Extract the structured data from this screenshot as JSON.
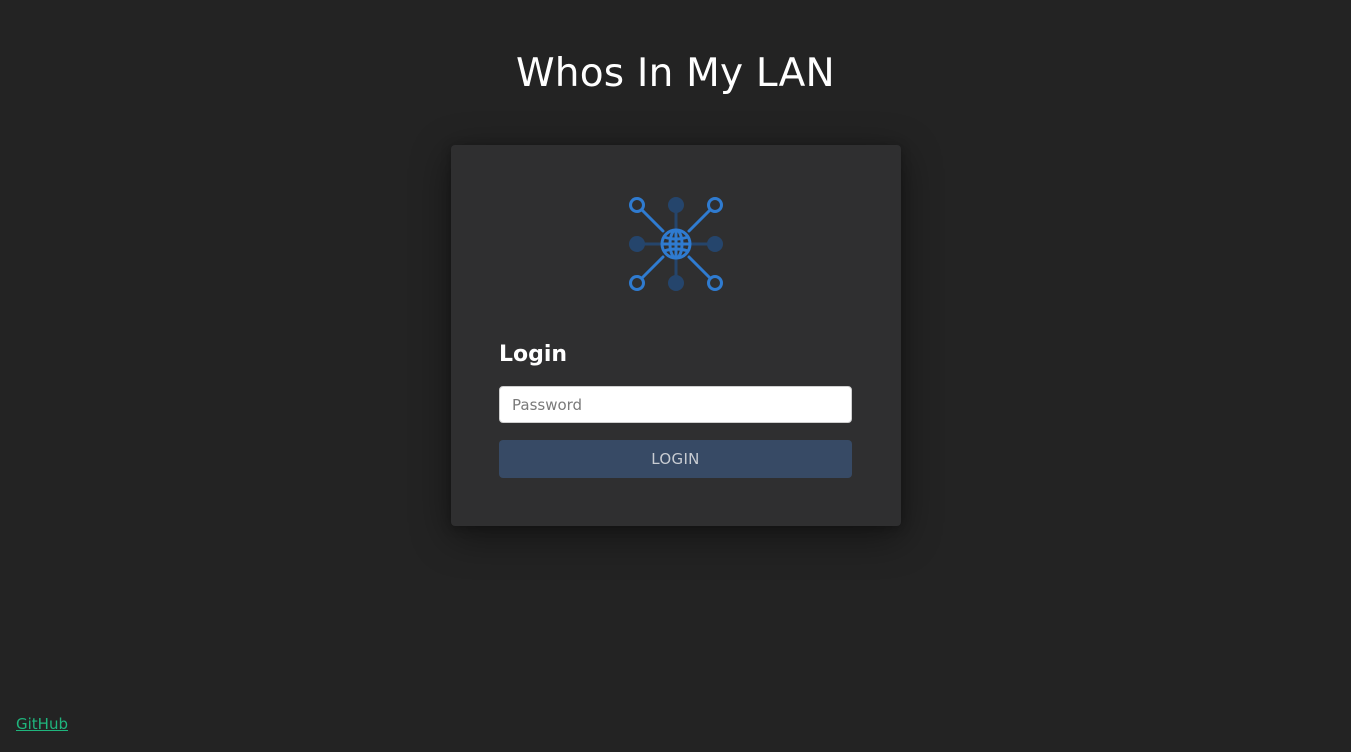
{
  "header": {
    "title": "Whos In My LAN"
  },
  "login_card": {
    "logo_icon": "network-globe-icon",
    "heading": "Login",
    "password_placeholder": "Password",
    "password_value": "",
    "button_label": "LOGIN"
  },
  "footer": {
    "github_link": "GitHub"
  },
  "colors": {
    "background": "#232323",
    "card": "#2f2f30",
    "button": "#374a65",
    "icon_blue": "#2f7bd0",
    "icon_dark_node": "#25456c",
    "link": "#1fb57d"
  }
}
